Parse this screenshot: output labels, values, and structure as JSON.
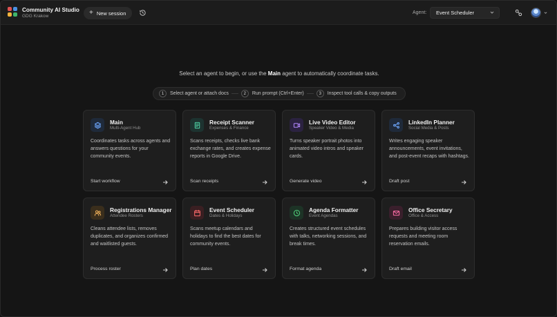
{
  "brand": {
    "title": "Community AI Studio",
    "subtitle": "GDG Krakow"
  },
  "header": {
    "new_session": "New session",
    "agent_label": "Agent:",
    "agent_selected": "Event Scheduler",
    "icons": [
      "history-icon",
      "link-icon",
      "chevron-down-icon"
    ]
  },
  "intro": {
    "prefix": "Select an agent to begin, or use the ",
    "bold": "Main",
    "suffix": " agent to automatically coordinate tasks."
  },
  "steps": [
    {
      "num": "1",
      "label": "Select agent or attach docs"
    },
    {
      "num": "2",
      "label": "Run prompt (Ctrl+Enter)"
    },
    {
      "num": "3",
      "label": "Inspect tool calls & copy outputs"
    }
  ],
  "cards": [
    {
      "title": "Main",
      "subtitle": "Multi-Agent Hub",
      "description": "Coordinates tasks across agents and answers questions for your community events.",
      "action": "Start workflow",
      "icon": "layers-icon",
      "color": "#6ea8ff"
    },
    {
      "title": "Receipt Scanner",
      "subtitle": "Expenses & Finance",
      "description": "Scans receipts, checks live bank exchange rates, and creates expense reports in Google Drive.",
      "action": "Scan receipts",
      "icon": "receipt-icon",
      "color": "#4fd1a5"
    },
    {
      "title": "Live Video Editor",
      "subtitle": "Speaker Video & Media",
      "description": "Turns speaker portrait photos into animated video intros and speaker cards.",
      "action": "Generate video",
      "icon": "video-icon",
      "color": "#b388ff"
    },
    {
      "title": "LinkedIn Planner",
      "subtitle": "Social Media & Posts",
      "description": "Writes engaging speaker announcements, event invitations, and post-event recaps with hashtags.",
      "action": "Draft post",
      "icon": "share-icon",
      "color": "#6ea8ff"
    },
    {
      "title": "Registrations Manager",
      "subtitle": "Attendee Rosters",
      "description": "Cleans attendee lists, removes duplicates, and organizes confirmed and waitlisted guests.",
      "action": "Process roster",
      "icon": "users-icon",
      "color": "#f2b35b"
    },
    {
      "title": "Event Scheduler",
      "subtitle": "Dates & Holidays",
      "description": "Scans meetup calendars and holidays to find the best dates for community events.",
      "action": "Plan dates",
      "icon": "calendar-icon",
      "color": "#ff6b6b"
    },
    {
      "title": "Agenda Formatter",
      "subtitle": "Event Agendas",
      "description": "Creates structured event schedules with talks, networking sessions, and break times.",
      "action": "Format agenda",
      "icon": "clock-icon",
      "color": "#4fd17a"
    },
    {
      "title": "Office Secretary",
      "subtitle": "Office & Access",
      "description": "Prepares building visitor access requests and meeting room reservation emails.",
      "action": "Draft email",
      "icon": "mail-icon",
      "color": "#ff6fa8"
    }
  ],
  "colors": {
    "logo": [
      "#e05252",
      "#4a90e2",
      "#f2b33d",
      "#3fb56b"
    ],
    "accent": "#6ea8ff"
  }
}
